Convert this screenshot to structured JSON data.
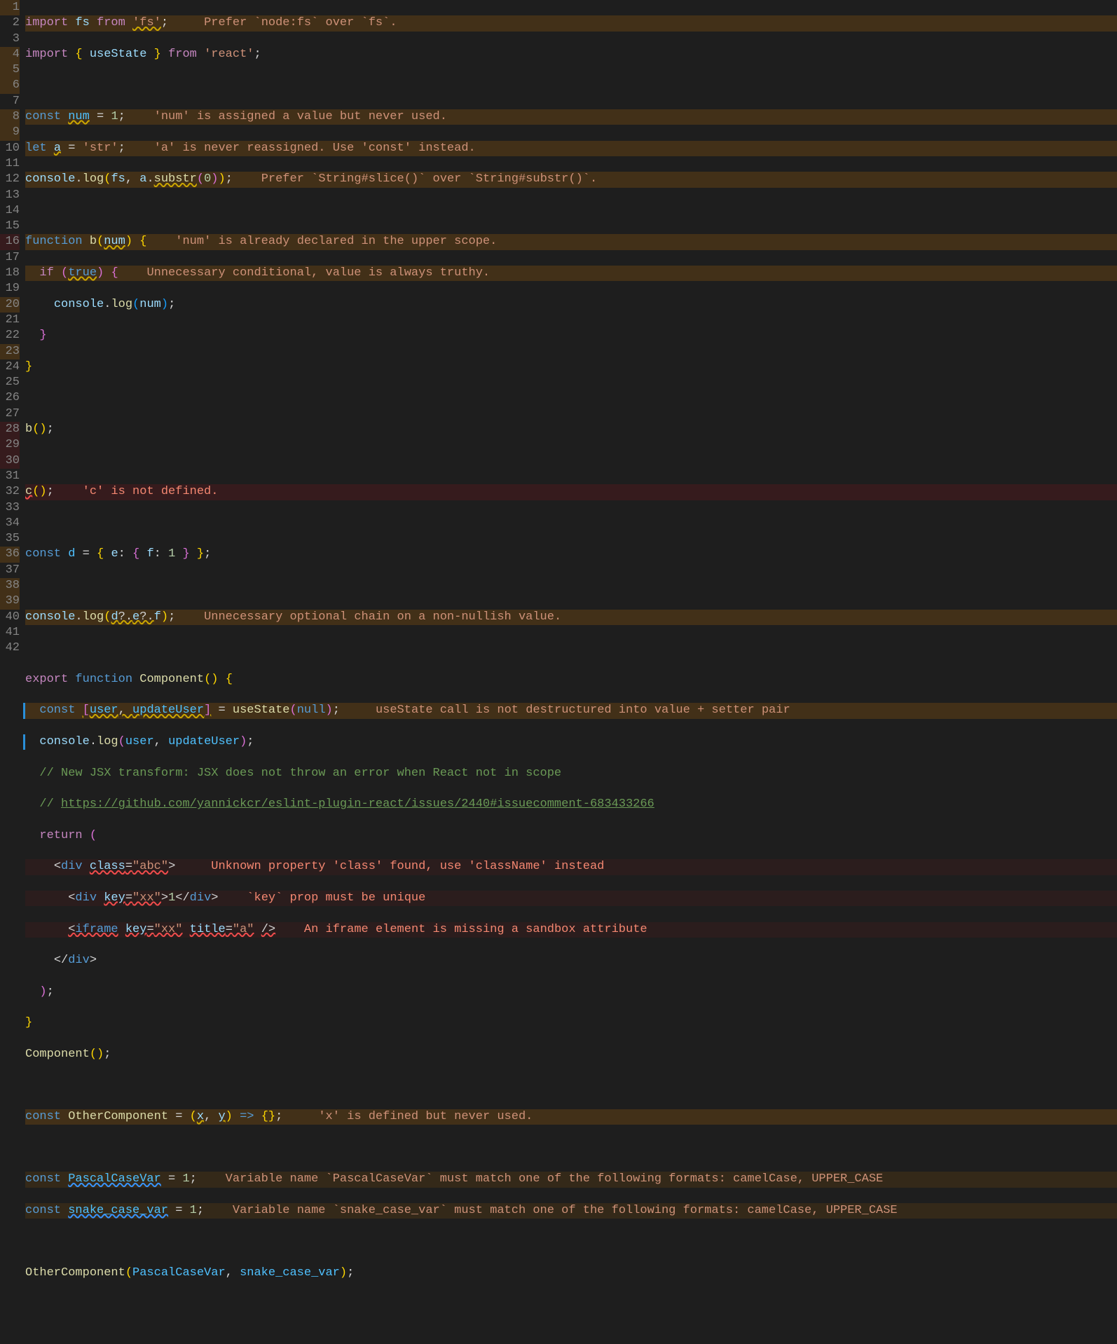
{
  "lines": {
    "1": {
      "hint": "Prefer `node:fs` over `fs`."
    },
    "4": {
      "hint": "'num' is assigned a value but never used."
    },
    "5": {
      "hint": "'a' is never reassigned. Use 'const' instead."
    },
    "6": {
      "hint": "Prefer `String#slice()` over `String#substr()`."
    },
    "8": {
      "hint": "'num' is already declared in the upper scope."
    },
    "9": {
      "hint": "Unnecessary conditional, value is always truthy."
    },
    "16": {
      "hint": "'c' is not defined."
    },
    "20": {
      "hint": "Unnecessary optional chain on a non-nullish value."
    },
    "23": {
      "hint": "useState call is not destructured into value + setter pair"
    },
    "25": {
      "comment": "// New JSX transform: JSX does not throw an error when React not in scope"
    },
    "26": {
      "comment": "// ",
      "url": "https://github.com/yannickcr/eslint-plugin-react/issues/2440#issuecomment-683433266"
    },
    "28": {
      "hint": "Unknown property 'class' found, use 'className' instead"
    },
    "29": {
      "hint": "`key` prop must be unique"
    },
    "30": {
      "hint": "An iframe element is missing a sandbox attribute"
    },
    "36": {
      "hint": "'x' is defined but never used."
    },
    "38": {
      "hint": "Variable name `PascalCaseVar` must match one of the following formats: camelCase, UPPER_CASE"
    },
    "39": {
      "hint": "Variable name `snake_case_var` must match one of the following formats: camelCase, UPPER_CASE"
    }
  },
  "t": {
    "import": "import",
    "from": "from",
    "const": "const",
    "let": "let",
    "function": "function",
    "if": "if",
    "export": "export",
    "return": "return",
    "null": "null",
    "true": "true",
    "fs": "fs",
    "fs_str": "'fs'",
    "react_str": "'react'",
    "useState": "useState",
    "num": "num",
    "one": "1",
    "a": "a",
    "str_str": "'str'",
    "console": "console",
    "log": "log",
    "substr": "substr",
    "zero": "0",
    "b": "b",
    "c": "c",
    "d": "d",
    "e": "e",
    "f": "f",
    "Component": "Component",
    "user": "user",
    "updateUser": "updateUser",
    "div": "div",
    "iframe": "iframe",
    "class_attr": "class",
    "abc": "\"abc\"",
    "key": "key",
    "xx": "\"xx\"",
    "title_attr": "title",
    "a_str": "\"a\"",
    "OtherComponent": "OtherComponent",
    "x": "x",
    "y": "y",
    "PascalCaseVar": "PascalCaseVar",
    "snake_case_var": "snake_case_var"
  },
  "line_numbers": [
    "1",
    "2",
    "3",
    "4",
    "5",
    "6",
    "7",
    "8",
    "9",
    "10",
    "11",
    "12",
    "13",
    "14",
    "15",
    "16",
    "17",
    "18",
    "19",
    "20",
    "21",
    "22",
    "23",
    "24",
    "25",
    "26",
    "27",
    "28",
    "29",
    "30",
    "31",
    "32",
    "33",
    "34",
    "35",
    "36",
    "37",
    "38",
    "39",
    "40",
    "41",
    "42"
  ]
}
